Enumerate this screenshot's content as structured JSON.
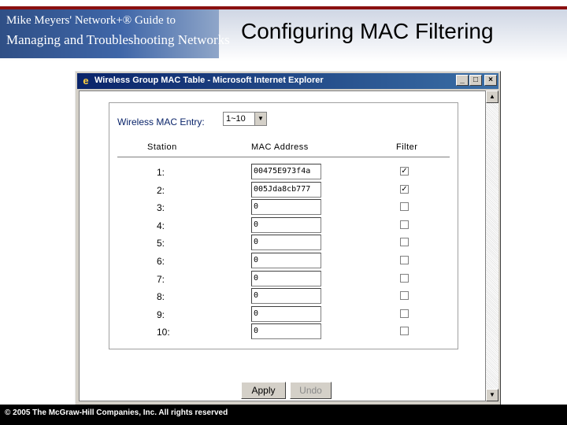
{
  "header": {
    "logo_line1": "Mike Meyers' Network+® Guide to",
    "logo_line2": "Managing and Troubleshooting Networks",
    "slide_title": "Configuring MAC Filtering"
  },
  "footer": {
    "copyright": "© 2005 The McGraw-Hill Companies, Inc. All rights reserved"
  },
  "window": {
    "title": "Wireless Group MAC Table - Microsoft Internet Explorer",
    "controls": {
      "minimize": "_",
      "maximize": "□",
      "close": "×"
    },
    "icons": {
      "app": "ie-icon"
    }
  },
  "form": {
    "entry_label": "Wireless MAC Entry:",
    "entry_value": "1~10",
    "columns": {
      "station": "Station",
      "mac": "MAC Address",
      "filter": "Filter"
    },
    "rows": [
      {
        "station": "1:",
        "mac": "00475E973f4a",
        "filter": true
      },
      {
        "station": "2:",
        "mac": "005Jda8cb777",
        "filter": true
      },
      {
        "station": "3:",
        "mac": "0",
        "filter": false
      },
      {
        "station": "4:",
        "mac": "0",
        "filter": false
      },
      {
        "station": "5:",
        "mac": "0",
        "filter": false
      },
      {
        "station": "6:",
        "mac": "0",
        "filter": false
      },
      {
        "station": "7:",
        "mac": "0",
        "filter": false
      },
      {
        "station": "8:",
        "mac": "0",
        "filter": false
      },
      {
        "station": "9:",
        "mac": "0",
        "filter": false
      },
      {
        "station": "10:",
        "mac": "0",
        "filter": false
      }
    ],
    "apply_label": "Apply",
    "undo_label": "Undo"
  },
  "colors": {
    "title_bar_start": "#0a246a",
    "title_bar_end": "#3a6ea5",
    "label_blue": "#0a246a",
    "header_red": "#8a1010"
  }
}
